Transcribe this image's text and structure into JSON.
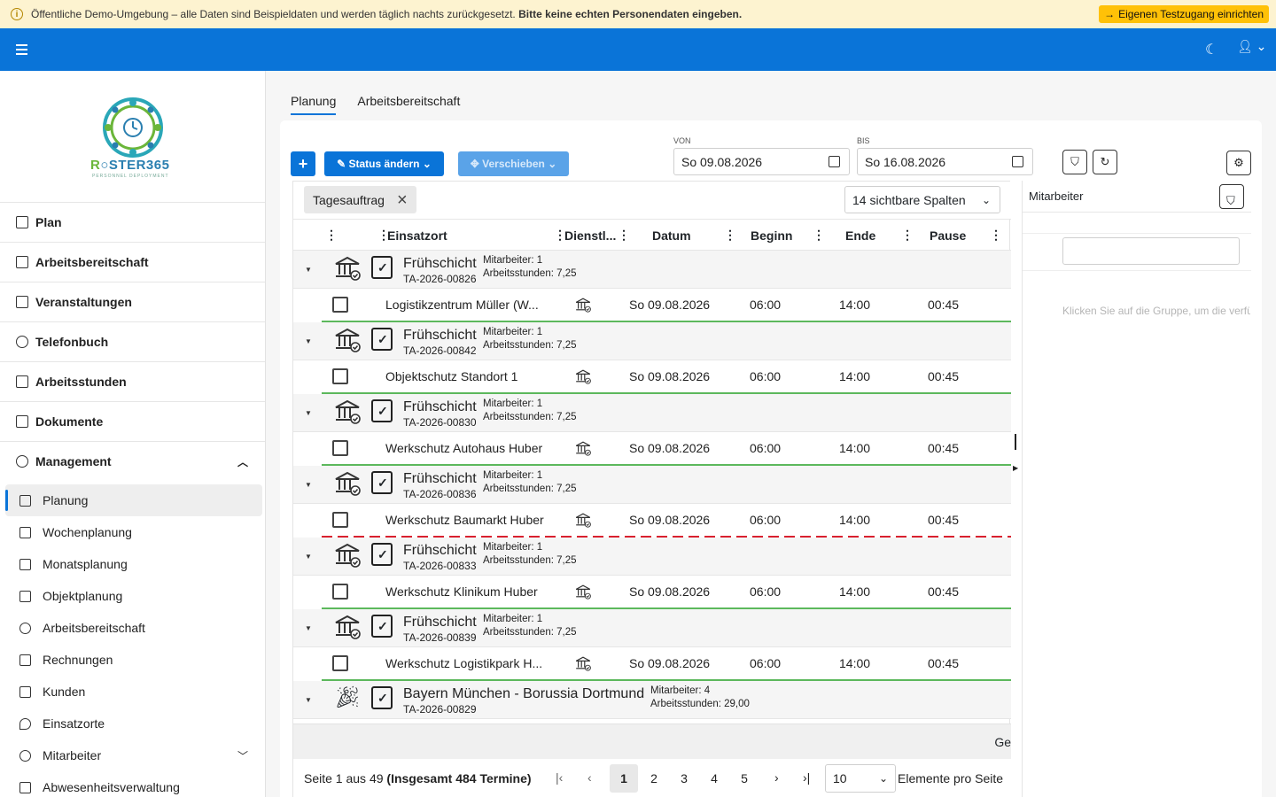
{
  "banner": {
    "text": "Öffentliche Demo-Umgebung – alle Daten sind Beispieldaten und werden täglich nachts zurückgesetzt.",
    "bold": "Bitte keine echten Personendaten eingeben.",
    "cta": "Eigenen Testzugang einrichten"
  },
  "logo": {
    "part1": "R",
    "part2": "STER365",
    "sub": "PERSONNEL DEPLOYMENT"
  },
  "nav": [
    {
      "label": "Plan"
    },
    {
      "label": "Arbeitsbereitschaft"
    },
    {
      "label": "Veranstaltungen"
    },
    {
      "label": "Telefonbuch"
    },
    {
      "label": "Arbeitsstunden"
    },
    {
      "label": "Dokumente"
    },
    {
      "label": "Management"
    }
  ],
  "subnav": [
    {
      "label": "Planung"
    },
    {
      "label": "Wochenplanung"
    },
    {
      "label": "Monatsplanung"
    },
    {
      "label": "Objektplanung"
    },
    {
      "label": "Arbeitsbereitschaft"
    },
    {
      "label": "Rechnungen"
    },
    {
      "label": "Kunden"
    },
    {
      "label": "Einsatzorte"
    },
    {
      "label": "Mitarbeiter"
    },
    {
      "label": "Abwesenheitsverwaltung"
    }
  ],
  "tabs": [
    {
      "label": "Planung"
    },
    {
      "label": "Arbeitsbereitschaft"
    }
  ],
  "toolbar": {
    "add": "+",
    "status": "Status ändern",
    "move": "Verschieben",
    "from_label": "VON",
    "from_value": "So 09.08.2026",
    "to_label": "BIS",
    "to_value": "So 16.08.2026"
  },
  "grid": {
    "group_chip": "Tagesauftrag",
    "columns_select": "14 sichtbare Spalten",
    "headers": [
      "Einsatzort",
      "Dienstl...",
      "Datum",
      "Beginn",
      "Ende",
      "Pause"
    ],
    "groups": [
      {
        "title": "Frühschicht",
        "code": "TA-2026-00826",
        "mitarbeiter": "Mitarbeiter: 1",
        "stunden": "Arbeitsstunden: 7,25",
        "row": {
          "ort": "Logistikzentrum Müller (W...",
          "datum": "So 09.08.2026",
          "beginn": "06:00",
          "ende": "14:00",
          "pause": "00:45"
        }
      },
      {
        "title": "Frühschicht",
        "code": "TA-2026-00842",
        "mitarbeiter": "Mitarbeiter: 1",
        "stunden": "Arbeitsstunden: 7,25",
        "row": {
          "ort": "Objektschutz Standort 1",
          "datum": "So 09.08.2026",
          "beginn": "06:00",
          "ende": "14:00",
          "pause": "00:45"
        }
      },
      {
        "title": "Frühschicht",
        "code": "TA-2026-00830",
        "mitarbeiter": "Mitarbeiter: 1",
        "stunden": "Arbeitsstunden: 7,25",
        "row": {
          "ort": "Werkschutz Autohaus Huber",
          "datum": "So 09.08.2026",
          "beginn": "06:00",
          "ende": "14:00",
          "pause": "00:45"
        }
      },
      {
        "title": "Frühschicht",
        "code": "TA-2026-00836",
        "mitarbeiter": "Mitarbeiter: 1",
        "stunden": "Arbeitsstunden: 7,25",
        "row": {
          "ort": "Werkschutz Baumarkt Huber",
          "datum": "So 09.08.2026",
          "beginn": "06:00",
          "ende": "14:00",
          "pause": "00:45"
        }
      },
      {
        "title": "Frühschicht",
        "code": "TA-2026-00833",
        "mitarbeiter": "Mitarbeiter: 1",
        "stunden": "Arbeitsstunden: 7,25",
        "row": {
          "ort": "Werkschutz Klinikum Huber",
          "datum": "So 09.08.2026",
          "beginn": "06:00",
          "ende": "14:00",
          "pause": "00:45"
        }
      },
      {
        "title": "Frühschicht",
        "code": "TA-2026-00839",
        "mitarbeiter": "Mitarbeiter: 1",
        "stunden": "Arbeitsstunden: 7,25",
        "row": {
          "ort": "Werkschutz Logistikpark H...",
          "datum": "So 09.08.2026",
          "beginn": "06:00",
          "ende": "14:00",
          "pause": "00:45"
        }
      },
      {
        "title": "Bayern München - Borussia Dortmund",
        "code": "TA-2026-00829",
        "mitarbeiter": "Mitarbeiter: 4",
        "stunden": "Arbeitsstunden: 29,00"
      }
    ],
    "footer_text": "Ge"
  },
  "pager": {
    "info": "Seite 1 aus 49",
    "total": "(Insgesamt 484 Termine)",
    "pages": [
      "1",
      "2",
      "3",
      "4",
      "5"
    ],
    "page_size": "10",
    "page_size_label": "Elemente pro Seite"
  },
  "side": {
    "title": "Mitarbeiter",
    "hint": "Klicken Sie auf die Gruppe, um die verfügbaren Mitarbeiter anzuzeigen"
  }
}
